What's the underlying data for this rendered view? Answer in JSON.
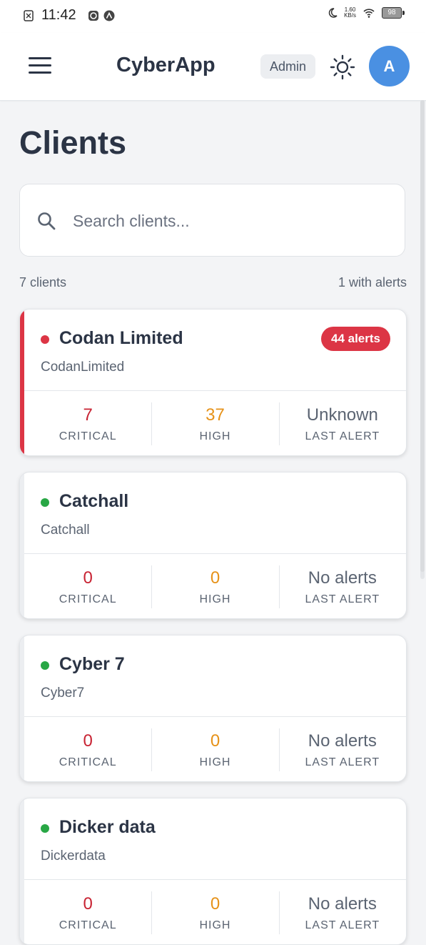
{
  "status_bar": {
    "time": "11:42",
    "net_speed": "1.60",
    "net_unit": "KB/s",
    "battery": "98"
  },
  "header": {
    "app_title": "CyberApp",
    "role": "Admin",
    "avatar_initial": "A"
  },
  "page": {
    "title": "Clients"
  },
  "search": {
    "placeholder": "Search clients..."
  },
  "summary": {
    "count_text": "7 clients",
    "alerts_text": "1 with alerts"
  },
  "labels": {
    "critical": "CRITICAL",
    "high": "HIGH",
    "last_alert": "LAST ALERT"
  },
  "clients": [
    {
      "name": "Codan Limited",
      "slug": "CodanLimited",
      "status_color": "#dc3545",
      "alert_badge": "44 alerts",
      "critical": "7",
      "high": "37",
      "last_alert": "Unknown"
    },
    {
      "name": "Catchall",
      "slug": "Catchall",
      "status_color": "#28a745",
      "critical": "0",
      "high": "0",
      "last_alert": "No alerts"
    },
    {
      "name": "Cyber 7",
      "slug": "Cyber7",
      "status_color": "#28a745",
      "critical": "0",
      "high": "0",
      "last_alert": "No alerts"
    },
    {
      "name": "Dicker data",
      "slug": "Dickerdata",
      "status_color": "#28a745",
      "critical": "0",
      "high": "0",
      "last_alert": "No alerts"
    }
  ],
  "colors": {
    "accent": "#4a90e2",
    "danger": "#dc3545",
    "warning": "#e69219",
    "ok": "#28a745"
  }
}
